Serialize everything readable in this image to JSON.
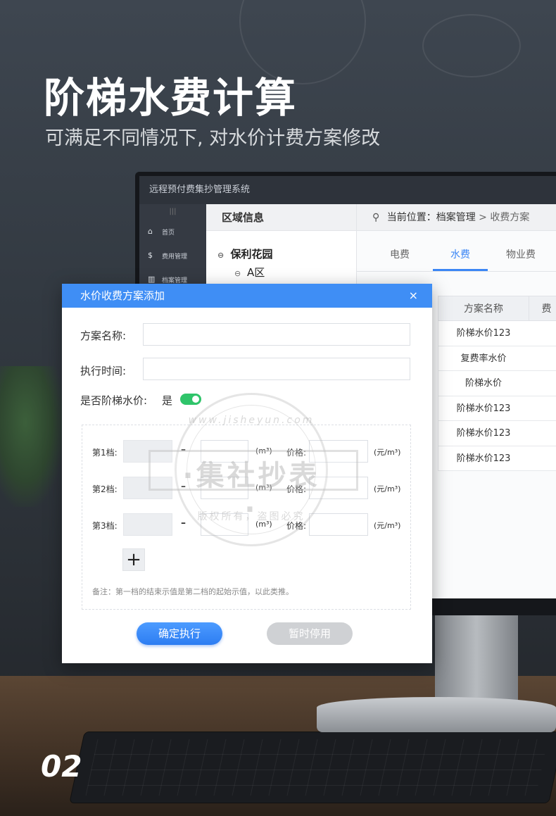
{
  "headline": "阶梯水费计算",
  "subline": "可满足不同情况下, 对水价计费方案修改",
  "page_number": "02",
  "app": {
    "title": "远程预付费集抄管理系统",
    "collapse_icon": "|||",
    "nav": [
      {
        "icon": "home-icon",
        "glyph": "⌂",
        "label": "首页"
      },
      {
        "icon": "fee-icon",
        "glyph": "$",
        "label": "费用管理"
      },
      {
        "icon": "archive-icon",
        "glyph": "▥",
        "label": "档案管理"
      }
    ],
    "region_header": "区域信息",
    "tree": [
      {
        "toggle": "⊖",
        "label": "保利花园"
      },
      {
        "toggle": "⊖",
        "label": "A区"
      }
    ],
    "breadcrumb": {
      "prefix": "当前位置：档案管理",
      "separator": ">",
      "current": "收费方案"
    },
    "tabs": [
      {
        "label": "电费",
        "active": false
      },
      {
        "label": "水费",
        "active": true
      },
      {
        "label": "物业费",
        "active": false
      }
    ],
    "table": {
      "headers": [
        "方案名称",
        "费"
      ],
      "rows": [
        "阶梯水价123",
        "复费率水价",
        "阶梯水价",
        "阶梯水价123",
        "阶梯水价123",
        "阶梯水价123"
      ]
    }
  },
  "dialog": {
    "title": "水价收费方案添加",
    "close": "×",
    "plan_name_label": "方案名称:",
    "plan_name_value": "",
    "exec_time_label": "执行时间:",
    "exec_time_value": "",
    "tiered_label": "是否阶梯水价:",
    "tiered_value": "是",
    "tiered_on": true,
    "tiers": [
      {
        "label": "第1档:",
        "dash": "–",
        "unit": "(m³)",
        "price_label": "价格:",
        "price_unit": "(元/m³)"
      },
      {
        "label": "第2档:",
        "dash": "–",
        "unit": "(m³)",
        "price_label": "价格:",
        "price_unit": "(元/m³)"
      },
      {
        "label": "第3档:",
        "dash": "–",
        "unit": "(m³)",
        "price_label": "价格:",
        "price_unit": "(元/m³)"
      }
    ],
    "add_icon": "+",
    "note": "备注：第一档的结束示值是第二档的起始示值，以此类推。",
    "confirm_label": "确定执行",
    "pause_label": "暂时停用"
  },
  "watermark": {
    "url": "www.jisheyun.com",
    "text": "·集社抄表·",
    "bottom": "版权所有，盗图必究"
  },
  "colors": {
    "accent": "#3f8ef5",
    "toggle_on": "#2fc46a",
    "tab_active": "#3b86f5",
    "button_disabled": "#cfd1d4"
  }
}
